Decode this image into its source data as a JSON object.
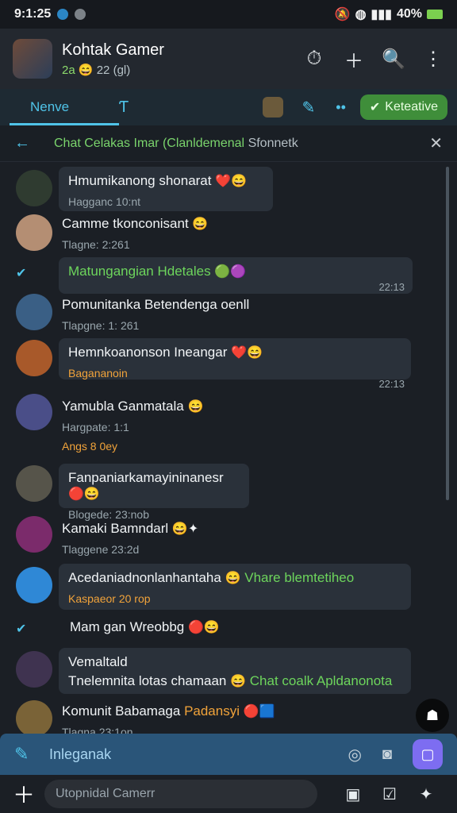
{
  "status_bar": {
    "time": "9:1:25",
    "signal_text": "40%",
    "colors": {
      "accent": "#4fc3e8",
      "battery": "#7bd04f"
    }
  },
  "header": {
    "title": "Kohtak Gamer",
    "subtitle_green": "2a",
    "subtitle_emoji": "😄",
    "subtitle_rest": "22 (gl)",
    "icons": [
      "timer-icon",
      "add-icon",
      "search-icon",
      "more-vert-icon"
    ]
  },
  "tabs": {
    "active_label": "Nenve",
    "pill_label": "Keteative"
  },
  "subheader": {
    "back_symbol": "←",
    "title_green": "Chat Celakas Imar (Clanldemenal",
    "title_muted": "Sfonnetk",
    "close_symbol": "✕"
  },
  "messages": [
    {
      "title": "Hmumikanong shonarat",
      "sub": "Hagganc 10:nt",
      "emojis": "❤️😄"
    },
    {
      "title": "Camme tkonconisant",
      "sub": "Tlagne: 2:261",
      "emojis": "😄"
    },
    {
      "title": "Matungangian Hdetales",
      "sub": "",
      "emojis": "🟢🟣",
      "time": "22:13"
    },
    {
      "title": "Pomunitanka Betendenga oenll",
      "sub": "Tlapgne: 1: 261",
      "emojis": ""
    },
    {
      "title": "Hemnkoanonson Ineangar",
      "sub": "Bagananoin",
      "emojis": "❤️😄",
      "time": "22:13"
    },
    {
      "title": "Yamubla Ganmatala",
      "sub": "Hargpate: 1:1",
      "emojis": "😄",
      "extra": "Angs 8 0ey"
    },
    {
      "title": "Fanpaniarkamayininanesr",
      "sub": "Blogede: 23:nob",
      "emojis": "🔴😄"
    },
    {
      "title": "Kamaki Bamndarl",
      "sub": "Tlaggene 23:2d",
      "emojis": "😄✦"
    },
    {
      "title": "Acedaniadnonlanhantaha",
      "sub": "Kaspaeor 20 rop",
      "emojis": "😄",
      "green_extra": "Vhare blemtetiheo"
    },
    {
      "title": "Mam gan Wreobbg",
      "sub": "",
      "emojis": "🔴😄"
    },
    {
      "title": "Vemaltald",
      "sub": "",
      "line2": "Tnelemnita lotas chamaan",
      "line2_green": "Chat coalk Apldanonota",
      "emojis": "😄"
    },
    {
      "title": "Komunit Babamaga",
      "title_orange": "Padansyi",
      "sub": "Tlagna 23:1on",
      "emojis": "🔴🟦"
    }
  ],
  "composer": {
    "text": "Inleganak"
  },
  "bottom_bar": {
    "placeholder": "Utopnidal Camerr"
  }
}
